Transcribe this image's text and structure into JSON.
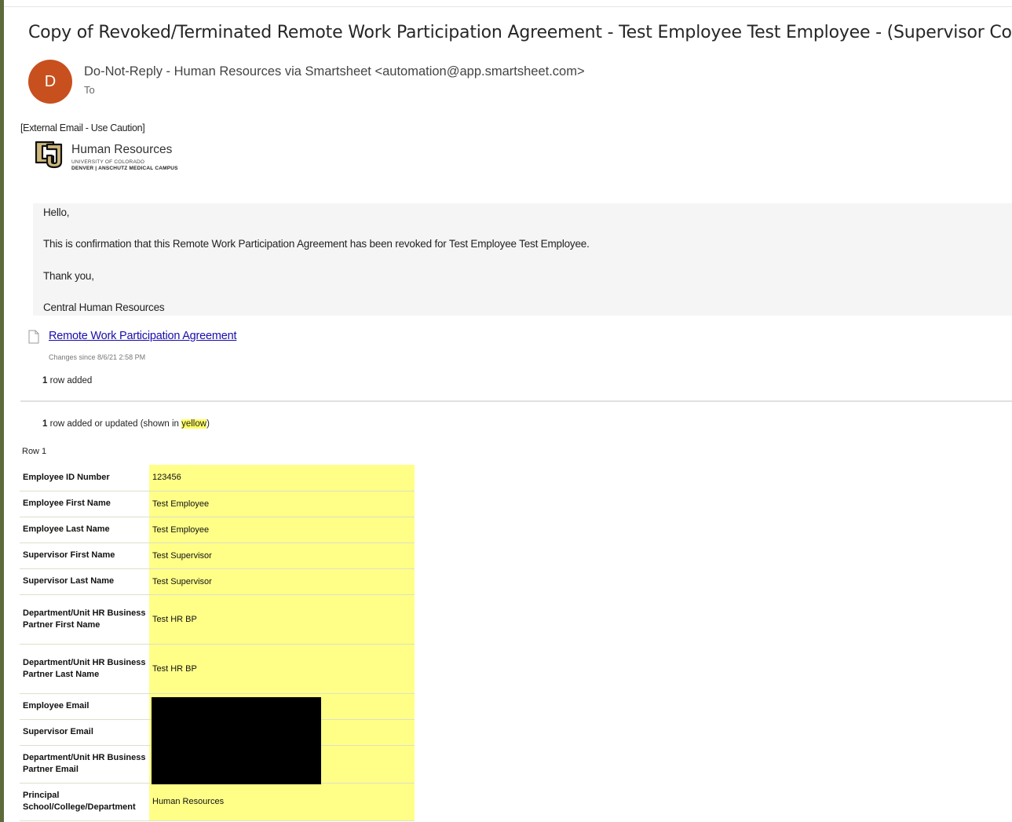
{
  "email": {
    "subject": "Copy of Revoked/Terminated Remote Work Participation Agreement - Test Employee Test Employee - (Supervisor Copy)",
    "avatar_initial": "D",
    "sender": "Do-Not-Reply - Human Resources via Smartsheet <automation@app.smartsheet.com>",
    "to_label": "To",
    "external_tag": "[External Email - Use Caution]"
  },
  "logo": {
    "title": "Human Resources",
    "sub1": "UNIVERSITY OF COLORADO",
    "sub2": "DENVER | ANSCHUTZ MEDICAL CAMPUS"
  },
  "message": {
    "greeting": "Hello,",
    "body": "This is confirmation that this Remote Work Participation Agreement has been revoked for Test Employee Test Employee.",
    "closing": "Thank you,",
    "signature": "Central Human Resources"
  },
  "sheet": {
    "link_text": "Remote Work Participation Agreement",
    "changes_since": "Changes since 8/6/21 2:58 PM",
    "row_added_count": "1",
    "row_added_text": "row added",
    "updated_count": "1",
    "updated_text_pre": "row added or updated (shown in ",
    "updated_highlight": "yellow",
    "updated_text_post": ")",
    "row_title": "Row 1"
  },
  "fields": [
    {
      "label": "Employee ID Number",
      "value": "123456"
    },
    {
      "label": "Employee First Name",
      "value": "Test Employee"
    },
    {
      "label": "Employee Last Name",
      "value": "Test Employee"
    },
    {
      "label": "Supervisor First Name",
      "value": "Test Supervisor"
    },
    {
      "label": "Supervisor Last Name",
      "value": "Test Supervisor"
    },
    {
      "label": "Department/Unit HR Business Partner First Name",
      "value": "Test HR BP"
    },
    {
      "label": "Department/Unit HR Business Partner Last Name",
      "value": "Test HR BP"
    },
    {
      "label": "Employee Email",
      "value": ""
    },
    {
      "label": "Supervisor Email",
      "value": ""
    },
    {
      "label": "Department/Unit HR Business Partner Email",
      "value": ""
    },
    {
      "label": "Principal School/College/Department",
      "value": "Human Resources"
    }
  ],
  "colors": {
    "avatar": "#c8501e",
    "highlight": "#ffff88",
    "link": "#1a0dab",
    "left_bar": "#5d6b3a"
  },
  "icons": [
    "document-icon",
    "cu-logo-icon"
  ]
}
